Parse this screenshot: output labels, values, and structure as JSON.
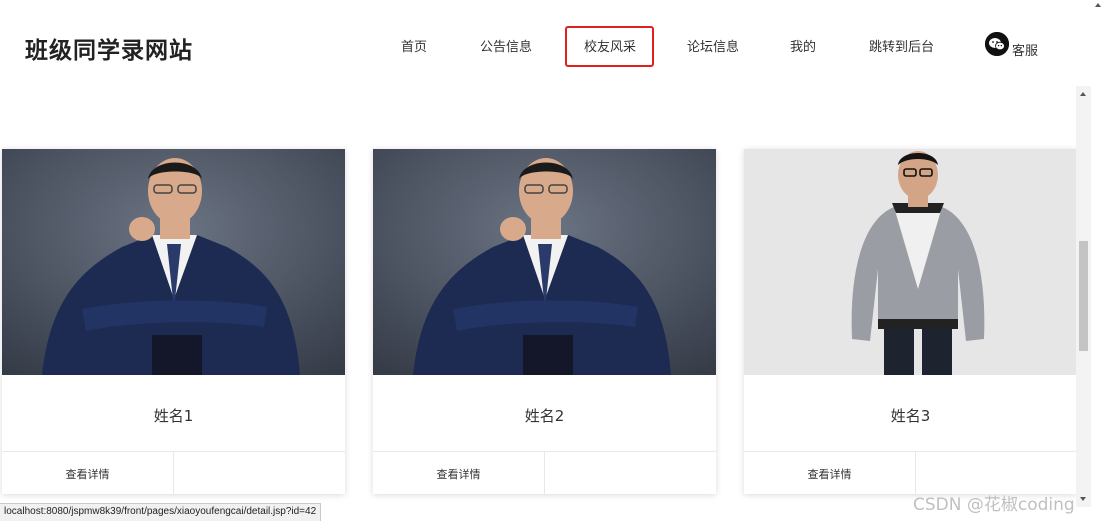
{
  "header": {
    "site_title": "班级同学录网站",
    "nav": [
      {
        "label": "首页"
      },
      {
        "label": "公告信息"
      },
      {
        "label": "校友风采",
        "active": true
      },
      {
        "label": "论坛信息"
      },
      {
        "label": "我的"
      },
      {
        "label": "跳转到后台"
      }
    ],
    "customer_service": {
      "icon": "wechat-icon",
      "label": "客服"
    },
    "active_highlight_color": "#e02020"
  },
  "cards": [
    {
      "name": "姓名1",
      "detail_label": "查看详情",
      "photo": "man-in-navy-suit-photo"
    },
    {
      "name": "姓名2",
      "detail_label": "查看详情",
      "photo": "man-in-navy-suit-photo"
    },
    {
      "name": "姓名3",
      "detail_label": "查看详情",
      "photo": "man-in-silver-jacket-photo"
    }
  ],
  "status_bar": {
    "url": "localhost:8080/jspmw8k39/front/pages/xiaoyoufengcai/detail.jsp?id=42"
  },
  "watermark": "CSDN @花椒coding"
}
